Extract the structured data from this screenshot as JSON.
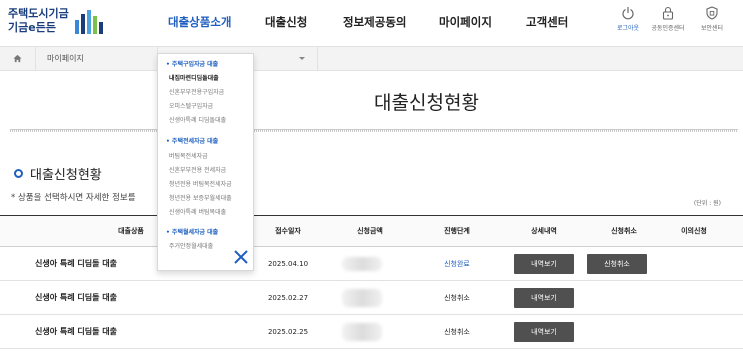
{
  "header": {
    "logo_line1": "주택도시기금",
    "logo_line2": "기금e든든",
    "nav": [
      "대출상품소개",
      "대출신청",
      "정보제공동의",
      "마이페이지",
      "고객센터"
    ],
    "util": [
      {
        "label": "로그아웃",
        "icon": "power-icon"
      },
      {
        "label": "공동인증센터",
        "icon": "lock-icon"
      },
      {
        "label": "보안센터",
        "icon": "shield-icon"
      }
    ]
  },
  "breadcrumb": {
    "level1": "마이페이지",
    "level2": ""
  },
  "page_title": "대출신청현황",
  "section_title": "대출신청현황",
  "guide_text": "* 상품을 선택하시면 자세한 정보를",
  "unit_text": "(단위 : 원)",
  "table": {
    "headers": [
      "대출상품",
      "접수일자",
      "신청금액",
      "진행단계",
      "상세내역",
      "신청취소",
      "이의신청"
    ],
    "rows": [
      {
        "product": "신생아 특례 디딤돌 대출",
        "date": "2025.04.10",
        "amount": "",
        "status": "신청완료",
        "detail_btn": "내역보기",
        "cancel_btn": "신청취소"
      },
      {
        "product": "신생아 특례 디딤돌 대출",
        "date": "2025.02.27",
        "amount": "",
        "status": "신청취소",
        "detail_btn": "내역보기",
        "cancel_btn": ""
      },
      {
        "product": "신생아 특례 디딤돌 대출",
        "date": "2025.02.25",
        "amount": "",
        "status": "신청취소",
        "detail_btn": "내역보기",
        "cancel_btn": ""
      }
    ]
  },
  "dropdown": {
    "groups": [
      {
        "title": "• 주택구입자금 대출",
        "items": [
          "내집마련디딤돌대출",
          "신혼부부전용구입자금",
          "오피스텔구입자금",
          "신생아특례 디딤돌대출"
        ]
      },
      {
        "title": "• 주택전세자금 대출",
        "items": [
          "버팀목전세자금",
          "신혼부부전용 전세자금",
          "청년전용 버팀목전세자금",
          "청년전용 보증부월세대출",
          "신생아특례 버팀목대출"
        ]
      },
      {
        "title": "• 주택월세자금 대출",
        "items": [
          "주거안정월세대출"
        ]
      }
    ],
    "selected": "내집마련디딤돌대출"
  },
  "colors": {
    "accent": "#1f5fbf",
    "button": "#505050",
    "logo": "#1a3d7c"
  }
}
